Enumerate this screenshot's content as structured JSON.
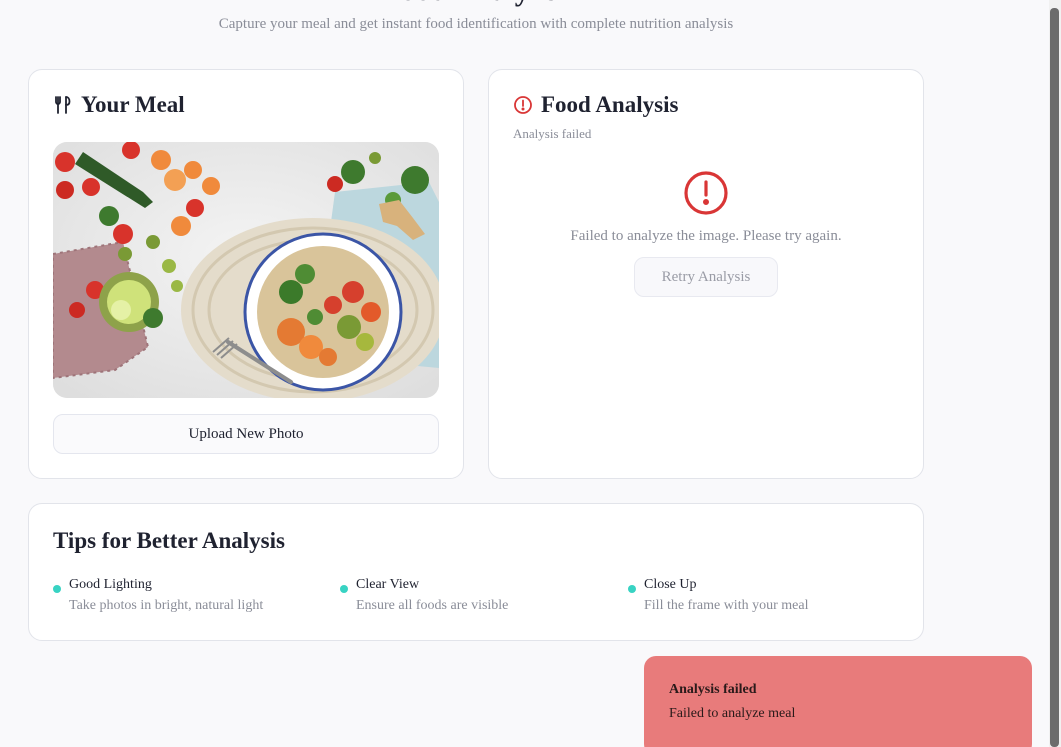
{
  "header": {
    "title": "Food Analyzer",
    "subtitle": "Capture your meal and get instant food identification with complete nutrition analysis"
  },
  "meal_card": {
    "icon": "utensils-icon",
    "title": "Your Meal",
    "photo_icon": "meal-photo",
    "upload_label": "Upload New Photo"
  },
  "analysis_card": {
    "icon": "alert-circle-icon",
    "title": "Food Analysis",
    "status": "Analysis failed",
    "error_message": "Failed to analyze the image. Please try again.",
    "retry_label": "Retry Analysis",
    "error_color": "#d93636"
  },
  "tips": {
    "title": "Tips for Better Analysis",
    "accent": "#38d3c3",
    "items": [
      {
        "title": "Good Lighting",
        "desc": "Take photos in bright, natural light"
      },
      {
        "title": "Clear View",
        "desc": "Ensure all foods are visible"
      },
      {
        "title": "Close Up",
        "desc": "Fill the frame with your meal"
      }
    ]
  },
  "toast": {
    "title": "Analysis failed",
    "description": "Failed to analyze meal",
    "color": "#e87b7b"
  }
}
